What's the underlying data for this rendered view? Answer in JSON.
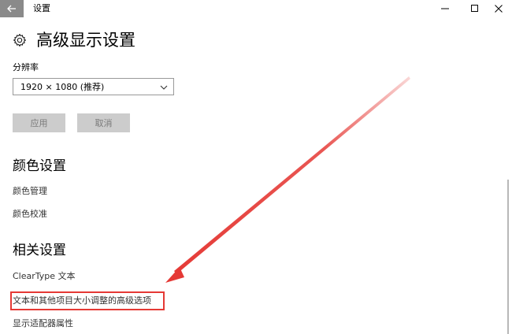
{
  "window": {
    "app_title": "设置",
    "back_icon": "back-arrow-icon",
    "controls": [
      "minimize-icon",
      "maximize-icon",
      "close-icon"
    ]
  },
  "page": {
    "icon": "gear-icon",
    "title": "高级显示设置"
  },
  "resolution": {
    "label": "分辨率",
    "selected": "1920 × 1080 (推荐)"
  },
  "buttons": {
    "apply": "应用",
    "cancel": "取消"
  },
  "color_settings": {
    "heading": "颜色设置",
    "links": [
      "颜色管理",
      "颜色校准"
    ]
  },
  "related_settings": {
    "heading": "相关设置",
    "links": [
      "ClearType 文本",
      "文本和其他项目大小调整的高级选项",
      "显示适配器属性"
    ]
  },
  "annotation": {
    "highlight_color": "#e53935"
  }
}
